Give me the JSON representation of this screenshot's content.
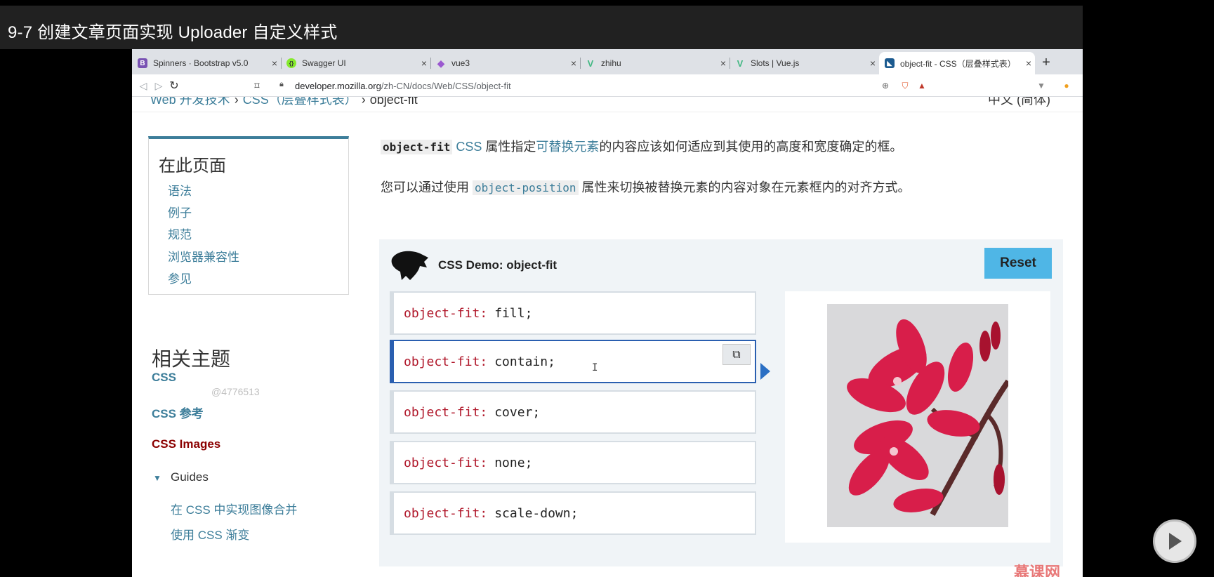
{
  "video": {
    "title": "9-7 创建文章页面实现 Uploader 自定义样式"
  },
  "browser": {
    "tabs": [
      {
        "label": "Spinners · Bootstrap v5.0",
        "icon": "bootstrap-icon",
        "icon_glyph": "B",
        "icon_color": "#7952b3"
      },
      {
        "label": "Swagger UI",
        "icon": "swagger-icon",
        "icon_glyph": "{}",
        "icon_color": "#85ea2d"
      },
      {
        "label": "vue3",
        "icon": "vite-icon",
        "icon_glyph": "◆",
        "icon_color": "#9b59d0"
      },
      {
        "label": "zhihu",
        "icon": "vue-icon",
        "icon_glyph": "V",
        "icon_color": "#42b883"
      },
      {
        "label": "Slots | Vue.js",
        "icon": "vue-icon",
        "icon_glyph": "V",
        "icon_color": "#42b883"
      },
      {
        "label": "object-fit - CSS（层叠样式表）",
        "icon": "mdn-icon",
        "icon_glyph": "◣",
        "icon_color": "#1b5a8f",
        "active": true
      }
    ],
    "close_glyph": "×",
    "new_tab_glyph": "+",
    "url": {
      "domain": "developer.mozilla.org",
      "path": "/zh-CN/docs/Web/CSS/object-fit"
    }
  },
  "page": {
    "breadcrumb": [
      "Web 开发技术",
      "CSS（层叠样式表）",
      "object-fit"
    ],
    "breadcrumb_sep": "›",
    "language": "中文 (简体)",
    "toc": {
      "title": "在此页面",
      "items": [
        "语法",
        "例子",
        "规范",
        "浏览器兼容性",
        "参见"
      ]
    },
    "related": {
      "title": "相关主题",
      "links": [
        "CSS",
        "CSS 参考",
        "CSS Images"
      ],
      "watermark": "@4776513",
      "guides_toggle": "▼",
      "guides_label": "Guides",
      "guide_links": [
        "在 CSS 中实现图像合并",
        "使用 CSS 渐变"
      ]
    },
    "intro": {
      "code": "object-fit",
      "css_link": "CSS",
      "text_before_link": " 属性指定",
      "replaced_link": "可替换元素",
      "text_after": "的内容应该如何适应到其使用的高度和宽度确定的框。"
    },
    "para2": {
      "text_before": "您可以通过使用 ",
      "code": "object-position",
      "text_after": " 属性来切换被替换元素的内容对象在元素框内的对齐方式。"
    },
    "demo": {
      "title": "CSS Demo: object-fit",
      "reset_label": "Reset",
      "property": "object-fit:",
      "choices": [
        "fill;",
        "contain;",
        "cover;",
        "none;",
        "scale-down;"
      ],
      "selected_index": 1,
      "copy_glyph": "⧉",
      "cursor_glyph": "I",
      "accent_color": "#2a5fb0"
    }
  },
  "overlay": {
    "logo": "慕课网",
    "play_glyph": "▶"
  }
}
